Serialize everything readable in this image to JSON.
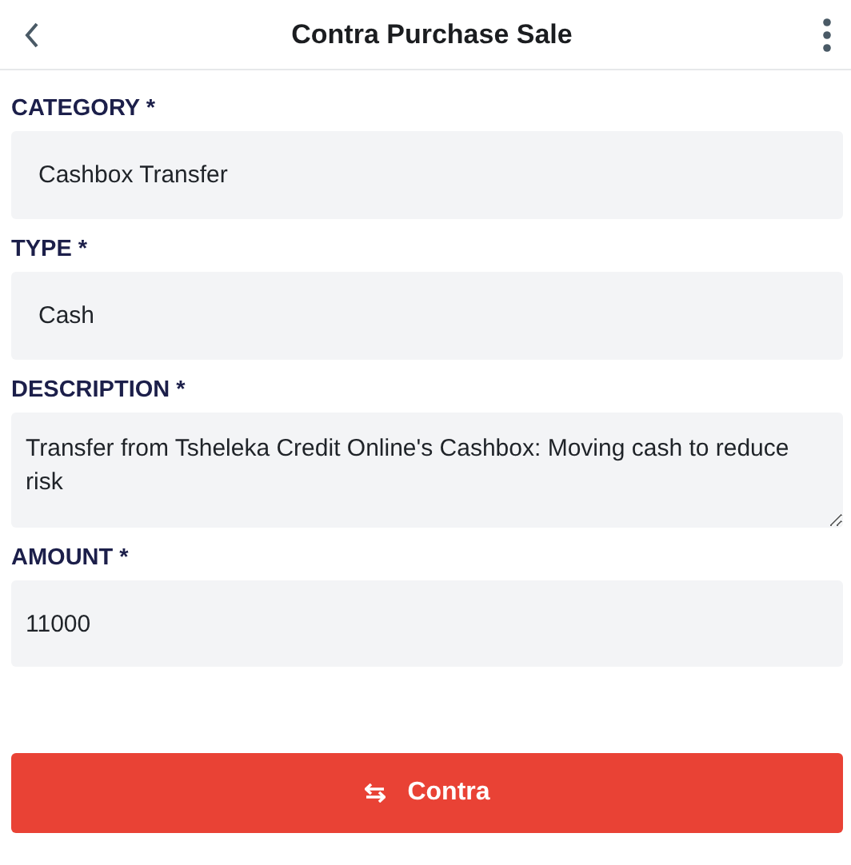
{
  "header": {
    "title": "Contra Purchase Sale"
  },
  "fields": [
    {
      "kind": "select",
      "label": "CATEGORY *",
      "value": "Cashbox Transfer"
    },
    {
      "kind": "select",
      "label": "TYPE *",
      "value": "Cash"
    },
    {
      "kind": "textarea",
      "label": "DESCRIPTION *",
      "value": "Transfer from Tsheleka Credit Online's Cashbox: Moving cash to reduce risk"
    },
    {
      "kind": "input",
      "label": "AMOUNT *",
      "value": "11000"
    }
  ],
  "submit_button": {
    "label": "Contra"
  }
}
